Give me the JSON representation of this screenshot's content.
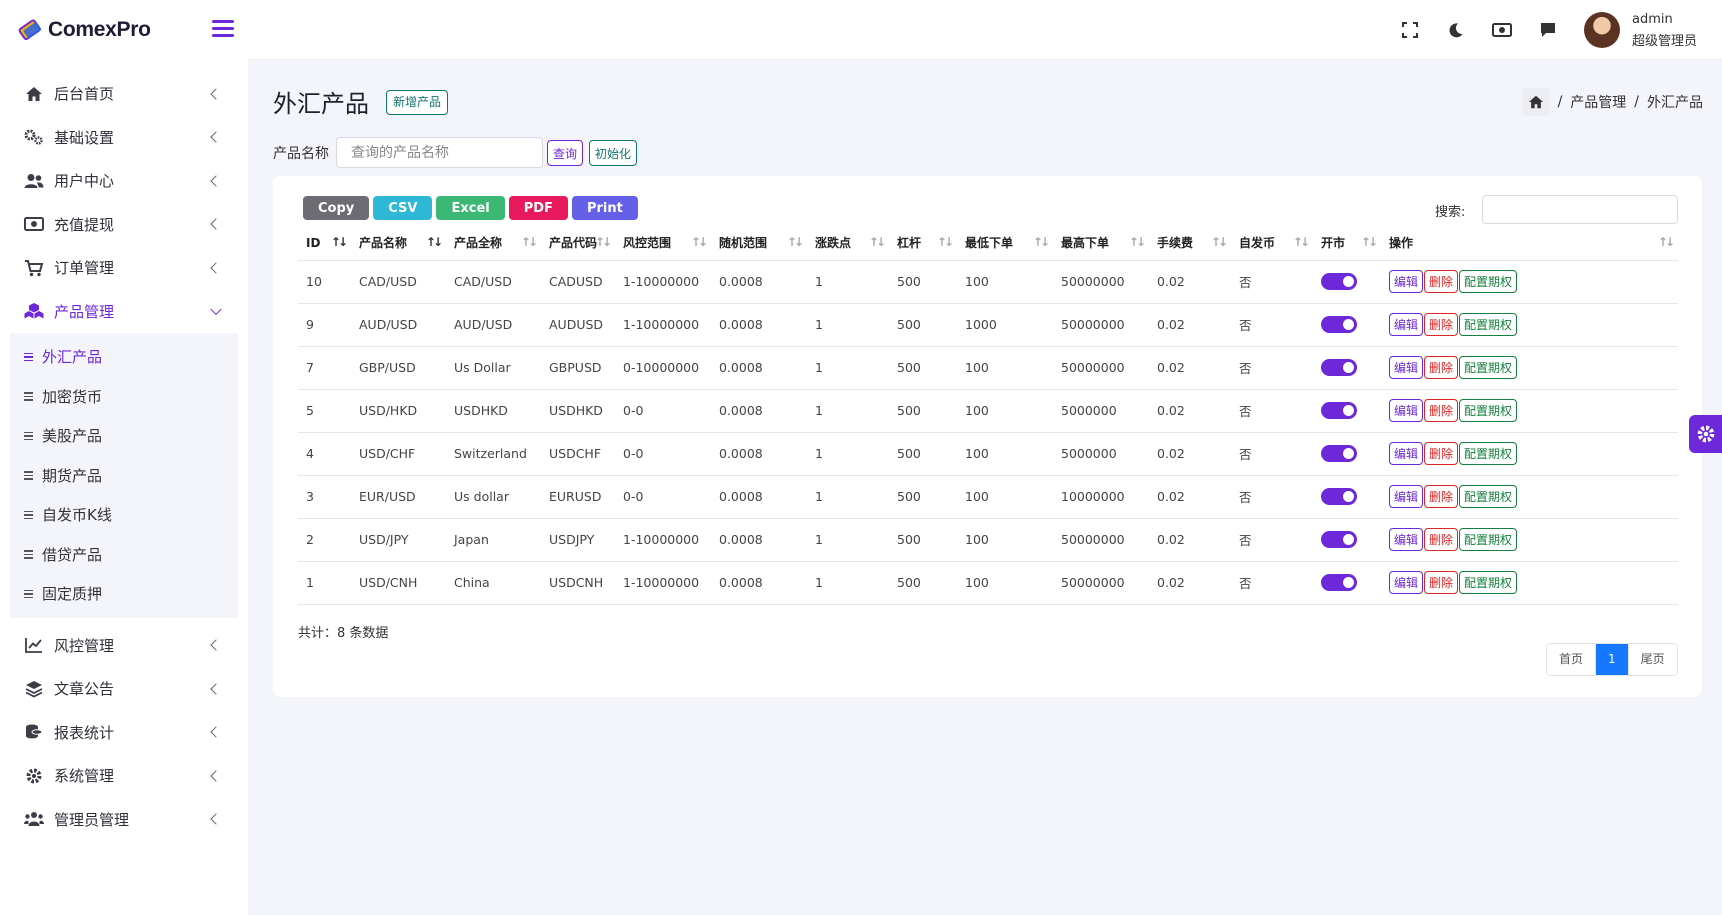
{
  "brand": {
    "name": "ComexPro"
  },
  "colors": {
    "accent": "#6d28d9",
    "danger": "#dc2626",
    "teal": "#0f766e",
    "success": "#15803d",
    "primary": "#1677ff"
  },
  "sidebar": {
    "items": [
      {
        "label": "后台首页",
        "icon": "home-icon"
      },
      {
        "label": "基础设置",
        "icon": "gears-icon"
      },
      {
        "label": "用户中心",
        "icon": "users-icon"
      },
      {
        "label": "充值提现",
        "icon": "money-icon"
      },
      {
        "label": "订单管理",
        "icon": "cart-icon"
      },
      {
        "label": "产品管理",
        "icon": "cubes-icon"
      }
    ],
    "sub_items": [
      "外汇产品",
      "加密货币",
      "美股产品",
      "期货产品",
      "自发币K线",
      "借贷产品",
      "固定质押"
    ],
    "items_after": [
      {
        "label": "风控管理",
        "icon": "chart-icon"
      },
      {
        "label": "文章公告",
        "icon": "layers-icon"
      },
      {
        "label": "报表统计",
        "icon": "coins-icon"
      },
      {
        "label": "系统管理",
        "icon": "gear-icon"
      },
      {
        "label": "管理员管理",
        "icon": "admins-icon"
      }
    ]
  },
  "topbar": {
    "user_name": "admin",
    "user_role": "超级管理员"
  },
  "page": {
    "title": "外汇产品",
    "add_button": "新增产品",
    "breadcrumb": [
      "产品管理",
      "外汇产品"
    ],
    "breadcrumb_sep": "/"
  },
  "filter": {
    "label": "产品名称",
    "placeholder": "查询的产品名称",
    "query": "查询",
    "reset": "初始化"
  },
  "toolbar": {
    "buttons": [
      {
        "label": "Copy",
        "color": "#6c6c72"
      },
      {
        "label": "CSV",
        "color": "#2fb7d6"
      },
      {
        "label": "Excel",
        "color": "#3cb875"
      },
      {
        "label": "PDF",
        "color": "#e8195d"
      },
      {
        "label": "Print",
        "color": "#6460e8"
      }
    ],
    "search_label": "搜索:"
  },
  "table": {
    "headers": [
      "ID",
      "产品名称",
      "产品全称",
      "产品代码",
      "风控范围",
      "随机范围",
      "涨跌点",
      "杠杆",
      "最低下单",
      "最高下单",
      "手续费",
      "自发币",
      "开市",
      "操作"
    ],
    "rows": [
      [
        "10",
        "CAD/USD",
        "CAD/USD",
        "CADUSD",
        "1-10000000",
        "0.0008",
        "1",
        "500",
        "100",
        "50000000",
        "0.02",
        "否"
      ],
      [
        "9",
        "AUD/USD",
        "AUD/USD",
        "AUDUSD",
        "1-10000000",
        "0.0008",
        "1",
        "500",
        "1000",
        "50000000",
        "0.02",
        "否"
      ],
      [
        "7",
        "GBP/USD",
        "Us Dollar",
        "GBPUSD",
        "0-10000000",
        "0.0008",
        "1",
        "500",
        "100",
        "50000000",
        "0.02",
        "否"
      ],
      [
        "5",
        "USD/HKD",
        "USDHKD",
        "USDHKD",
        "0-0",
        "0.0008",
        "1",
        "500",
        "100",
        "5000000",
        "0.02",
        "否"
      ],
      [
        "4",
        "USD/CHF",
        "Switzerland",
        "USDCHF",
        "0-0",
        "0.0008",
        "1",
        "500",
        "100",
        "5000000",
        "0.02",
        "否"
      ],
      [
        "3",
        "EUR/USD",
        "Us dollar",
        "EURUSD",
        "0-0",
        "0.0008",
        "1",
        "500",
        "100",
        "10000000",
        "0.02",
        "否"
      ],
      [
        "2",
        "USD/JPY",
        "Japan",
        "USDJPY",
        "1-10000000",
        "0.0008",
        "1",
        "500",
        "100",
        "50000000",
        "0.02",
        "否"
      ],
      [
        "1",
        "USD/CNH",
        "China",
        "USDCNH",
        "1-10000000",
        "0.0008",
        "1",
        "500",
        "100",
        "50000000",
        "0.02",
        "否"
      ]
    ],
    "actions": {
      "edit": "编辑",
      "delete": "删除",
      "option": "配置期权"
    },
    "total": "共计：8 条数据"
  },
  "pagination": {
    "first": "首页",
    "current": "1",
    "last": "尾页"
  }
}
